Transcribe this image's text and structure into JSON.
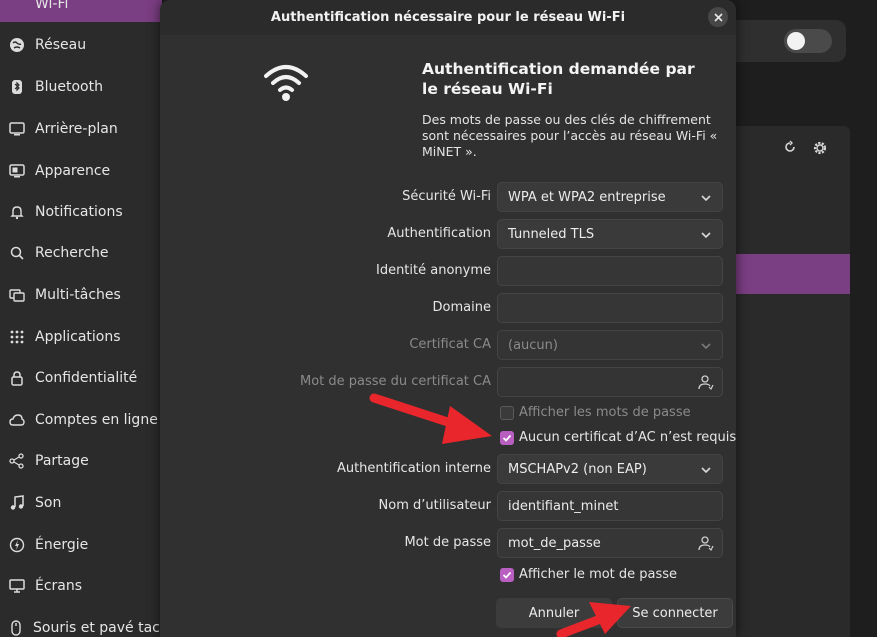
{
  "sidebar": {
    "active_item": "Wi-Fi",
    "items": [
      {
        "label": "Réseau",
        "icon": "globe-icon"
      },
      {
        "label": "Bluetooth",
        "icon": "bluetooth-icon"
      },
      {
        "label": "Arrière-plan",
        "icon": "monitor-icon"
      },
      {
        "label": "Apparence",
        "icon": "palette-icon"
      },
      {
        "label": "Notifications",
        "icon": "bell-icon"
      },
      {
        "label": "Recherche",
        "icon": "search-icon"
      },
      {
        "label": "Multi-tâches",
        "icon": "windows-icon"
      },
      {
        "label": "Applications",
        "icon": "grid-icon"
      },
      {
        "label": "Confidentialité",
        "icon": "lock-icon"
      },
      {
        "label": "Comptes en ligne",
        "icon": "cloud-icon"
      },
      {
        "label": "Partage",
        "icon": "share-icon"
      },
      {
        "label": "Son",
        "icon": "music-icon"
      },
      {
        "label": "Énergie",
        "icon": "power-icon"
      },
      {
        "label": "Écrans",
        "icon": "display-icon"
      },
      {
        "label": "Souris et pavé tactile",
        "icon": "mouse-icon"
      }
    ]
  },
  "dialog": {
    "title": "Authentification nécessaire pour le réseau Wi-Fi",
    "heading": "Authentification demandée par le réseau Wi-Fi",
    "description": "Des mots de passe ou des clés de chiffrement sont nécessaires pour l’accès au réseau Wi-Fi « MiNET ».",
    "fields": {
      "security": {
        "label": "Sécurité Wi-Fi",
        "value": "WPA et WPA2 entreprise"
      },
      "authentication": {
        "label": "Authentification",
        "value": "Tunneled TLS"
      },
      "anonymous_identity": {
        "label": "Identité anonyme",
        "value": ""
      },
      "domain": {
        "label": "Domaine",
        "value": ""
      },
      "ca_certificate": {
        "label": "Certificat CA",
        "value": "(aucun)"
      },
      "ca_cert_password": {
        "label": "Mot de passe du certificat CA",
        "value": ""
      },
      "inner_auth": {
        "label": "Authentification interne",
        "value": "MSCHAPv2 (non EAP)"
      },
      "username": {
        "label": "Nom d’utilisateur",
        "value": "identifiant_minet"
      },
      "password": {
        "label": "Mot de passe",
        "value": "mot_de_passe"
      }
    },
    "checkboxes": {
      "show_passwords": {
        "label": "Afficher les mots de passe",
        "checked": false
      },
      "no_ca_required": {
        "label": "Aucun certificat d’AC n’est requis",
        "checked": true
      },
      "show_password": {
        "label": "Afficher le mot de passe",
        "checked": true
      }
    },
    "buttons": {
      "cancel": "Annuler",
      "connect": "Se connecter"
    }
  },
  "colors": {
    "accent": "#7a3e82",
    "checkbox": "#b85fc1",
    "annotation_arrow": "#e8262b"
  }
}
